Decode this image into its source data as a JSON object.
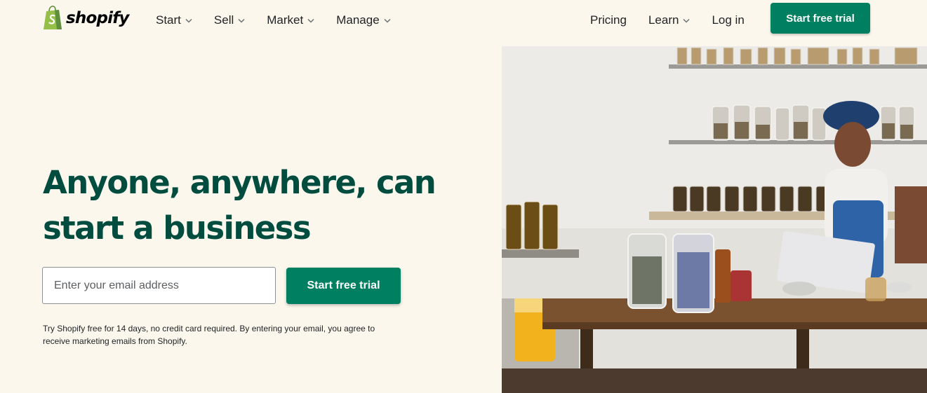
{
  "brand": {
    "name": "shopify",
    "color": "#95bf47"
  },
  "nav": {
    "left": [
      {
        "label": "Start",
        "has_dropdown": true
      },
      {
        "label": "Sell",
        "has_dropdown": true
      },
      {
        "label": "Market",
        "has_dropdown": true
      },
      {
        "label": "Manage",
        "has_dropdown": true
      }
    ],
    "right": [
      {
        "label": "Pricing",
        "has_dropdown": false
      },
      {
        "label": "Learn",
        "has_dropdown": true
      },
      {
        "label": "Log in",
        "has_dropdown": false
      }
    ],
    "cta_label": "Start free trial"
  },
  "hero": {
    "title": "Anyone, anywhere, can start a business",
    "email_placeholder": "Enter your email address",
    "cta_label": "Start free trial",
    "disclaimer": "Try Shopify free for 14 days, no credit card required. By entering your email, you agree to receive marketing emails from Shopify."
  },
  "colors": {
    "background": "#fbf7ed",
    "accent": "#008060",
    "heading": "#004c3f"
  },
  "icons": {
    "logo": "shopify-bag-icon",
    "dropdown": "chevron-down-icon"
  }
}
